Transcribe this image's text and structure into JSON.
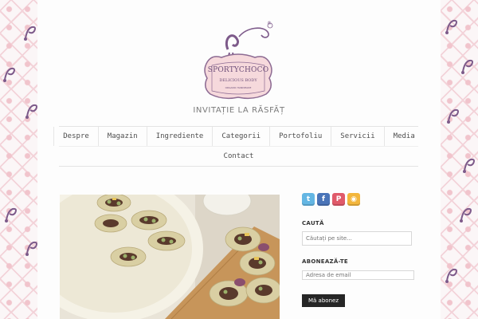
{
  "brand": {
    "name": "SPORTYCHOCO",
    "subtitle": "DELICIOUS BODY",
    "small_text": "ORGANIC HANDMADE",
    "registered_mark": "®",
    "tagline": "INVITAȚIE LA RĂSFĂȚ",
    "colors": {
      "accent": "#7d5a8a",
      "badge_fill": "#f6d9dc",
      "badge_stroke": "#8d6b93",
      "pattern": "#f1c4cc"
    }
  },
  "nav": {
    "items": [
      {
        "label": "Despre"
      },
      {
        "label": "Magazin"
      },
      {
        "label": "Ingrediente"
      },
      {
        "label": "Categorii"
      },
      {
        "label": "Portofoliu"
      },
      {
        "label": "Servicii"
      },
      {
        "label": "Media"
      },
      {
        "label": "Contact"
      }
    ]
  },
  "social": [
    {
      "icon": "twitter-icon",
      "glyph": "t",
      "color": "#64b6e3"
    },
    {
      "icon": "facebook-icon",
      "glyph": "f",
      "color": "#4a74b8"
    },
    {
      "icon": "pinterest-icon",
      "glyph": "P",
      "color": "#e05a6a"
    },
    {
      "icon": "rss-icon",
      "glyph": "◉",
      "color": "#f3b63c"
    }
  ],
  "search": {
    "title": "CAUTĂ",
    "placeholder": "Căutați pe site..."
  },
  "subscribe": {
    "title": "ABONEAZĂ-TE",
    "placeholder": "Adresa de email",
    "button_label": "Mă abonez"
  }
}
